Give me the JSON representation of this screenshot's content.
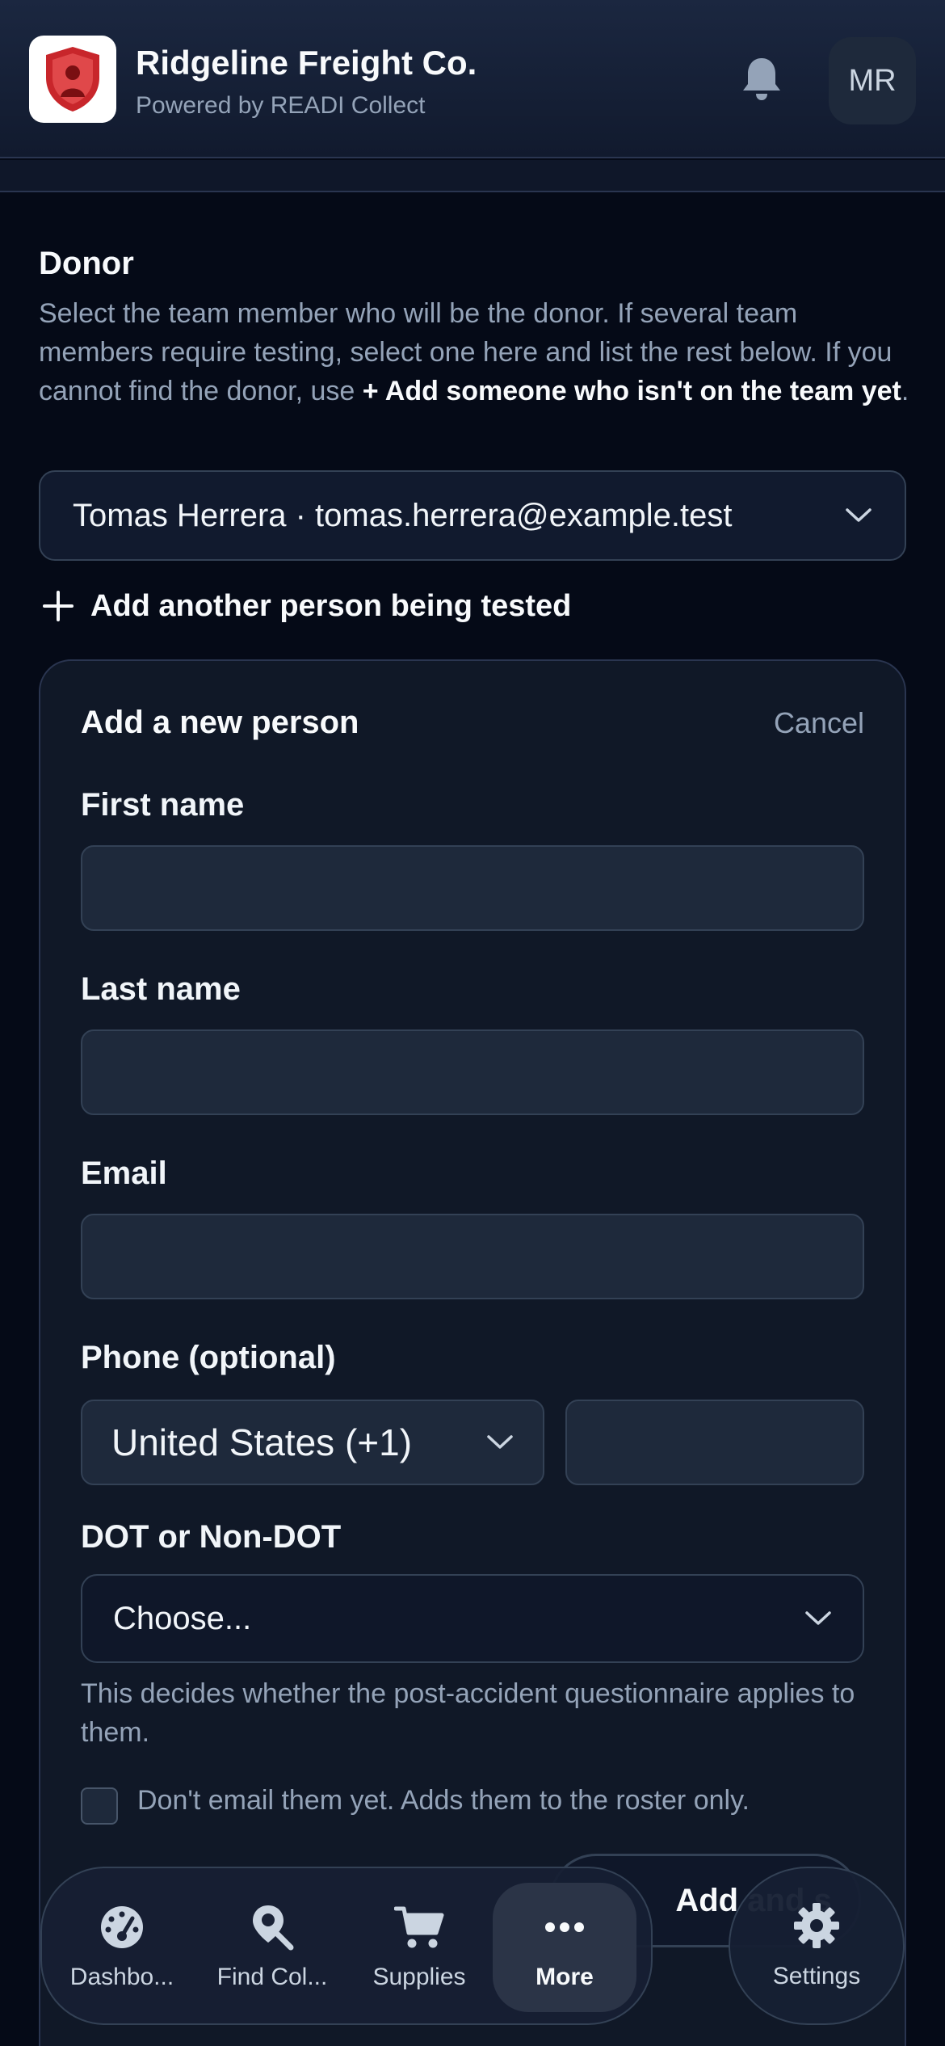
{
  "header": {
    "title": "Ridgeline Freight Co.",
    "subtitle": "Powered by READI Collect",
    "avatar_initials": "MR"
  },
  "donor": {
    "title": "Donor",
    "help_text": "Select the team member who will be the donor. If several team members require testing, select one here and list the rest below. If you cannot find the donor, use",
    "help_link": "+ Add someone who isn't on the team yet",
    "help_end": ".",
    "selected": "Tomas Herrera · tomas.herrera@example.test",
    "add_another": "Add another person being tested"
  },
  "new_person": {
    "title": "Add a new person",
    "cancel": "Cancel",
    "first_name_label": "First name",
    "first_name_value": "",
    "last_name_label": "Last name",
    "last_name_value": "",
    "email_label": "Email",
    "email_value": "",
    "phone_label": "Phone (optional)",
    "country_value": "United States (+1)",
    "phone_value": "",
    "dot_label": "DOT or Non-DOT",
    "dot_value": "Choose...",
    "dot_help": "This decides whether the post-accident questionnaire applies to them.",
    "no_email_label": "Don't email them yet. Adds them to the roster only.",
    "submit_label": "Add and s"
  },
  "nav": {
    "items": [
      {
        "label": "Dashbo...",
        "icon": "gauge-icon"
      },
      {
        "label": "Find Col...",
        "icon": "map-search-icon"
      },
      {
        "label": "Supplies",
        "icon": "cart-icon"
      },
      {
        "label": "More",
        "icon": "more-icon"
      }
    ],
    "settings": {
      "label": "Settings",
      "icon": "gear-icon"
    }
  },
  "colors": {
    "background": "#050a17",
    "card": "#101827",
    "input": "#1e293b",
    "logo_red": "#c8262b"
  }
}
